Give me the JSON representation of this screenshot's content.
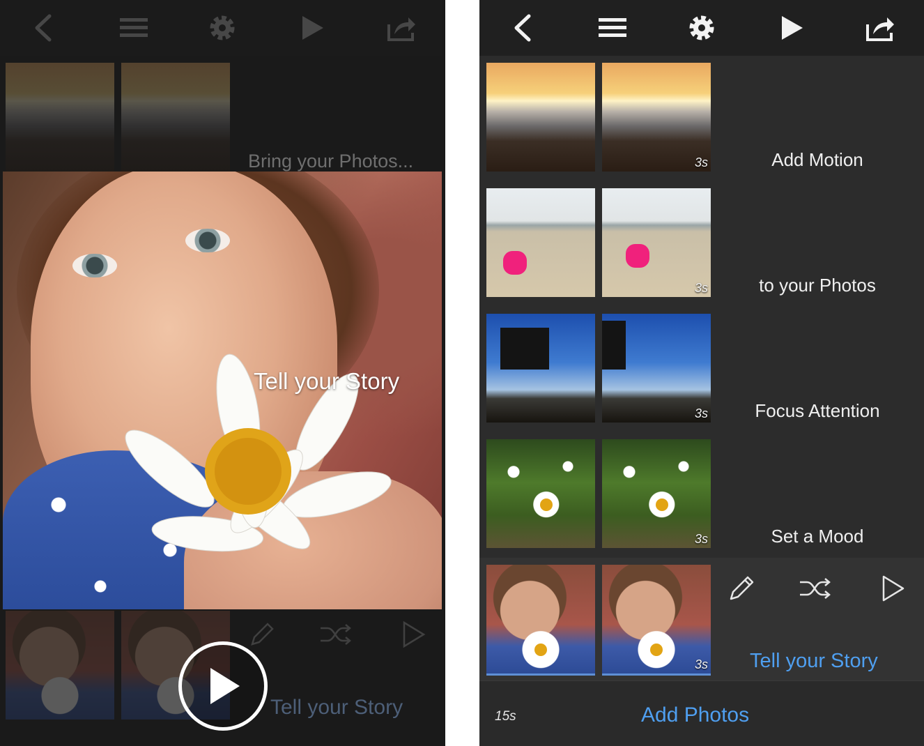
{
  "left_screen": {
    "faded_caption": "Bring your Photos...",
    "overlay_title": "Tell your Story",
    "faded_story_link": "Tell your Story"
  },
  "right_screen": {
    "rows": [
      {
        "label": "Add Motion",
        "duration": "3s"
      },
      {
        "label": "to your Photos",
        "duration": "3s"
      },
      {
        "label": "Focus Attention",
        "duration": "3s"
      },
      {
        "label": "Set a Mood",
        "duration": "3s"
      },
      {
        "duration": "3s"
      }
    ],
    "story_link": "Tell your Story",
    "footer": {
      "total_duration": "15s",
      "add_photos_label": "Add Photos"
    }
  },
  "icons": {
    "toolbar": [
      "back-chevron-icon",
      "menu-icon",
      "gear-icon",
      "play-icon",
      "share-icon"
    ],
    "actions": [
      "pencil-icon",
      "shuffle-icon",
      "play-outline-icon"
    ]
  },
  "colors": {
    "accent_blue": "#4f9ff0",
    "toolbar_bg": "#202020",
    "screen_bg": "#2c2c2c"
  }
}
